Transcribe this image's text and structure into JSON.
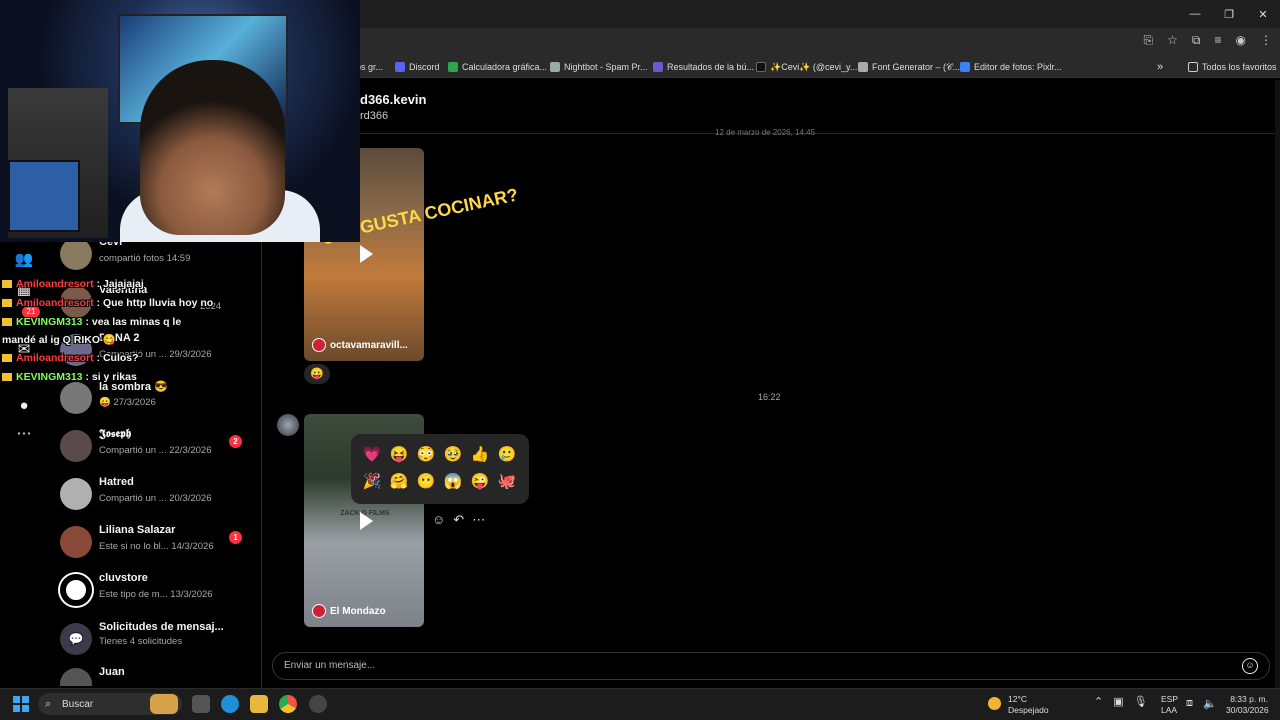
{
  "browser": {
    "bookmarks": [
      {
        "label": "os gr...",
        "color": "#888888"
      },
      {
        "label": "Discord",
        "color": "#5865F2"
      },
      {
        "label": "Calculadora gráfica...",
        "color": "#2ea44f"
      },
      {
        "label": "Nightbot - Spam Pr...",
        "color": "#9aa"
      },
      {
        "label": "Resultados de la bú...",
        "color": "#6a5acd"
      },
      {
        "label": "✨Cevi✨ (@cevi_y...",
        "color": "#111111"
      },
      {
        "label": "Font Generator – (𝒞...",
        "color": "#aaaaaa"
      },
      {
        "label": "Editor de fotos: Pixlr...",
        "color": "#3b82f6"
      }
    ],
    "all_favorites": "Todos los favoritos",
    "more": "»"
  },
  "chat_header": {
    "name": "d366.kevin",
    "username": "rd366"
  },
  "conversations": [
    {
      "name": "Cevi",
      "sub": "compartió fotos  14:59",
      "color": "#8a7a60",
      "badge": ""
    },
    {
      "name": "Valentina",
      "sub": "2024",
      "color": "#7a5a4a",
      "badge": ""
    },
    {
      "name": "DANA 2",
      "sub": "Compartió un ...  29/3/2026",
      "color": "#6a6a8a",
      "badge": ""
    },
    {
      "name": "la sombra 😎",
      "sub": "😛 27/3/2026",
      "color": "#777777",
      "badge": ""
    },
    {
      "name": "𝕵𝖔𝖘𝖊𝖕𝖍",
      "sub": "Compartió un ...  22/3/2026",
      "color": "#5a4a4a",
      "badge": "2"
    },
    {
      "name": "Hatred",
      "sub": "Compartió un ...  20/3/2026",
      "color": "#b0b0b0",
      "badge": ""
    },
    {
      "name": "Liliana Salazar",
      "sub": "Este si no lo bl...  14/3/2026",
      "color": "#8a4a3a",
      "badge": "1"
    },
    {
      "name": "cluvstore",
      "sub": "Este tipo de m...  13/3/2026",
      "color": "#ffffff",
      "badge": ""
    },
    {
      "name": "Solicitudes de mensaj...",
      "sub": "Tienes 4 solicitudes",
      "color": "#3a3a4a",
      "badge": ""
    },
    {
      "name": "Juan",
      "sub": "",
      "color": "#555555",
      "badge": ""
    }
  ],
  "stream_chat": [
    {
      "user": "Amiloandresort",
      "text": ": Jajajajaj",
      "color": "#ff3b3b"
    },
    {
      "user": "Amiloandresort",
      "text": ": Que http lluvia hoy no",
      "color": "#ff3b3b"
    },
    {
      "user": "KEVINGM313",
      "text": ": vea las minas q le",
      "color": "#7fff5a"
    },
    {
      "user": "",
      "text": "mandé al ig Q RIKO 😋",
      "color": "#ffffff"
    },
    {
      "user": "Amiloandresort",
      "text": ": Culos?",
      "color": "#ff3b3b"
    },
    {
      "user": "KEVINGM313",
      "text": ": si y rikas",
      "color": "#7fff5a"
    }
  ],
  "nav": {
    "badge": "21"
  },
  "messages": {
    "top_time": "12 de marzo de 2026, 14:45",
    "reel1_overlay": "¿TE GUSTA COCINAR?",
    "reel1_caption": "octavamaravill...",
    "reel1_reaction": "😛",
    "mid_time": "16:22",
    "reel2_caption": "El Mondazo",
    "reel2_shirt": "ZACK D FILMS"
  },
  "emoji_picker": {
    "row1": [
      "💗",
      "😝",
      "😳",
      "🥹",
      "👍",
      "🥲"
    ],
    "row2": [
      "🎉",
      "🤗",
      "😶",
      "😱",
      "😜",
      "🐙"
    ]
  },
  "composer": {
    "placeholder": "Enviar un mensaje..."
  },
  "taskbar": {
    "search": "Buscar",
    "temp": "12°C",
    "weather": "Despejado",
    "lang1": "ESP",
    "lang2": "LAA",
    "time": "8:33 p. m.",
    "date": "30/03/2026"
  }
}
